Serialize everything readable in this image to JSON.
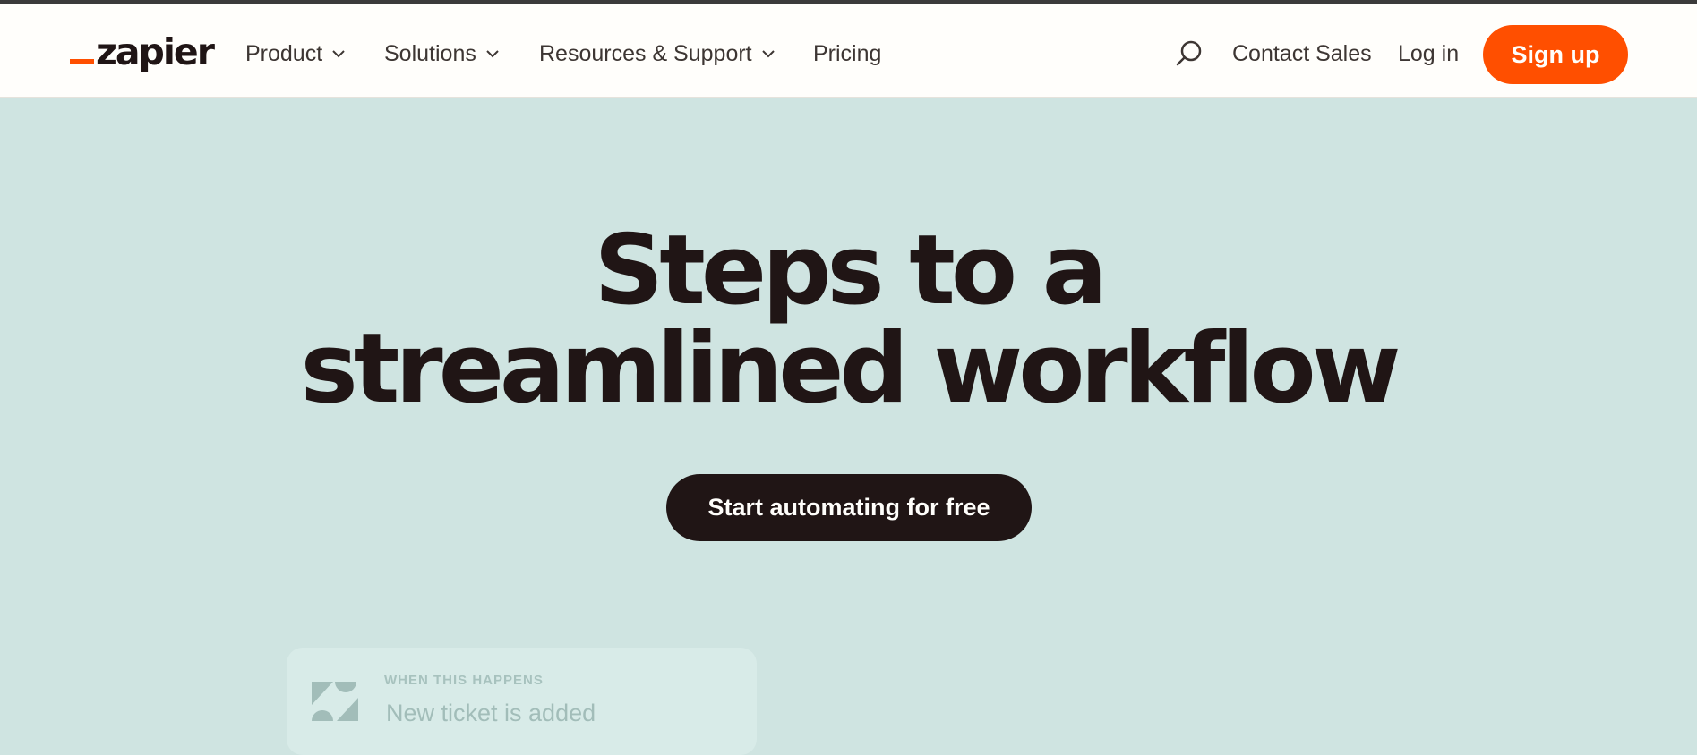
{
  "header": {
    "logo_text": "zapier",
    "nav": [
      {
        "label": "Product",
        "has_dropdown": true
      },
      {
        "label": "Solutions",
        "has_dropdown": true
      },
      {
        "label": "Resources & Support",
        "has_dropdown": true
      },
      {
        "label": "Pricing",
        "has_dropdown": false
      }
    ],
    "search_icon": "search-icon",
    "contact_sales": "Contact Sales",
    "log_in": "Log in",
    "sign_up": "Sign up"
  },
  "hero": {
    "title_line1": "Steps to a",
    "title_line2": "streamlined workflow",
    "cta": "Start automating for free"
  },
  "trigger_card": {
    "label": "WHEN THIS HAPPENS",
    "value": "New ticket is added",
    "icon": "zendesk-icon"
  },
  "colors": {
    "accent": "#ff4f00",
    "dark": "#201515",
    "hero_bg": "#cfe4e1",
    "nav_bg": "#fffefb"
  }
}
